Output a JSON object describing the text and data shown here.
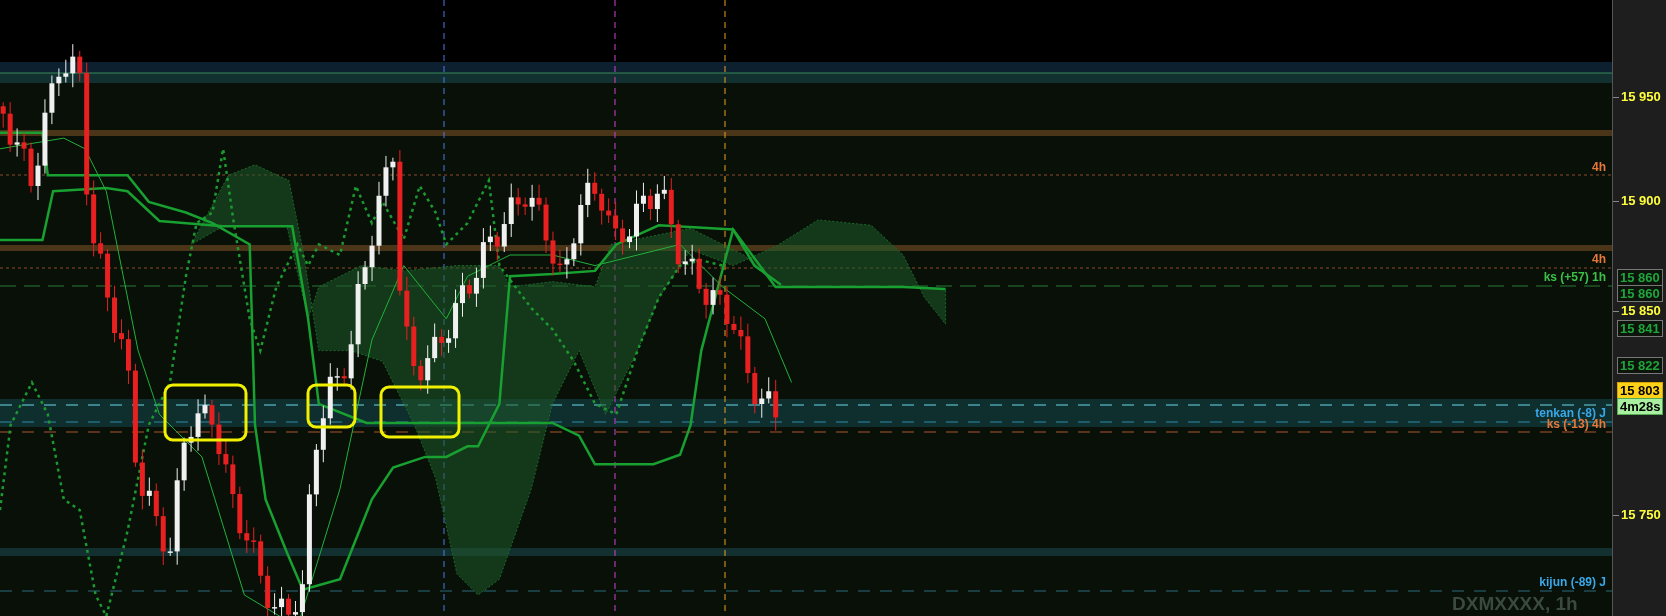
{
  "chart": {
    "symbol_watermark": "DXMXXXX, 1h",
    "line_labels": [
      {
        "text": "4h",
        "color": "#e8783a"
      },
      {
        "text": "4h",
        "color": "#e8783a"
      },
      {
        "text": "ks (+57) 1h",
        "color": "#3cc048"
      },
      {
        "text": "tenkan (-8) J",
        "color": "#3aa8e8"
      },
      {
        "text": "ks (-13) 4h",
        "color": "#e8783a"
      },
      {
        "text": "kijun (-89) J",
        "color": "#3aa8e8"
      }
    ]
  },
  "price_axis": {
    "ticks": [
      "15 950",
      "15 900",
      "15 850",
      "15 750"
    ],
    "labels": [
      {
        "text": "15 860",
        "kind": "level"
      },
      {
        "text": "15 860",
        "kind": "level"
      },
      {
        "text": "15 841",
        "kind": "level"
      },
      {
        "text": "15 822",
        "kind": "level"
      },
      {
        "text": "15 803",
        "kind": "current"
      },
      {
        "text": "4m28s",
        "kind": "timer"
      }
    ]
  }
}
